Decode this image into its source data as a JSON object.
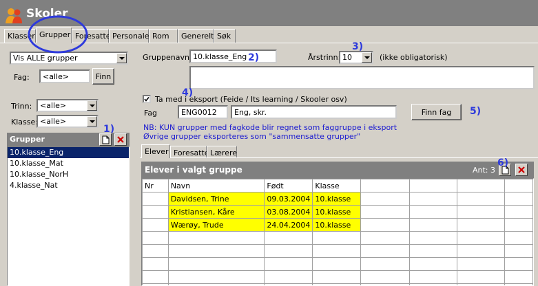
{
  "app": {
    "title": "Skoler"
  },
  "tabs": [
    "Klasser",
    "Grupper",
    "Foresatte",
    "Personale",
    "Rom",
    "Generelt",
    "Søk"
  ],
  "left": {
    "vis_combo": "Vis ALLE grupper",
    "fag_label": "Fag:",
    "fag_value": "<alle>",
    "finn_button": "Finn",
    "trinn_label": "Trinn:",
    "trinn_value": "<alle>",
    "klasse_label": "Klasse:",
    "klasse_value": "<alle>",
    "groups_header": "Grupper",
    "groups": [
      "10.klasse_Eng",
      "10.klasse_Mat",
      "10.klasse_NorH",
      "4.klasse_Nat"
    ],
    "selected_index": 0
  },
  "form": {
    "gruppenavn_label": "Gruppenavn:",
    "gruppenavn_value": "10.klasse_Eng",
    "arstrinn_label": "Årstrinn:",
    "arstrinn_value": "10",
    "ikke_obligatorisk": "(ikke obligatorisk)",
    "eksport_label": "Ta med i eksport (Feide / Its learning / Skooler osv)",
    "eksport_checked": true,
    "fag_label": "Fag",
    "fag_code": "ENG0012",
    "fag_name": "Eng, skr.",
    "finn_fag_button": "Finn fag",
    "note1": "NB: KUN grupper med fagkode blir regnet som faggruppe i eksport",
    "note2": "Øvrige grupper eksporteres som \"sammensatte grupper\""
  },
  "subtabs": [
    "Elever",
    "Foresatte",
    "Lærere"
  ],
  "students": {
    "header": "Elever i valgt gruppe",
    "count_label": "Ant: 3",
    "columns": [
      "Nr",
      "Navn",
      "Født",
      "Klasse"
    ],
    "rows": [
      {
        "nr": "",
        "navn": "Davidsen, Trine",
        "fodt": "09.03.2004",
        "klasse": "10.klasse"
      },
      {
        "nr": "",
        "navn": "Kristiansen, Kåre",
        "fodt": "03.08.2004",
        "klasse": "10.klasse"
      },
      {
        "nr": "",
        "navn": "Wærøy, Trude",
        "fodt": "24.04.2004",
        "klasse": "10.klasse"
      }
    ]
  },
  "annotations": [
    "1)",
    "2)",
    "3)",
    "4)",
    "5)",
    "6)"
  ],
  "colors": {
    "highlight": "#ffff00",
    "annotation": "#2e3adc",
    "selection": "#0a246a",
    "header": "#808080"
  },
  "icons": [
    "users-icon",
    "new-document-icon",
    "delete-icon",
    "dropdown-arrow-icon",
    "checkbox-icon"
  ]
}
